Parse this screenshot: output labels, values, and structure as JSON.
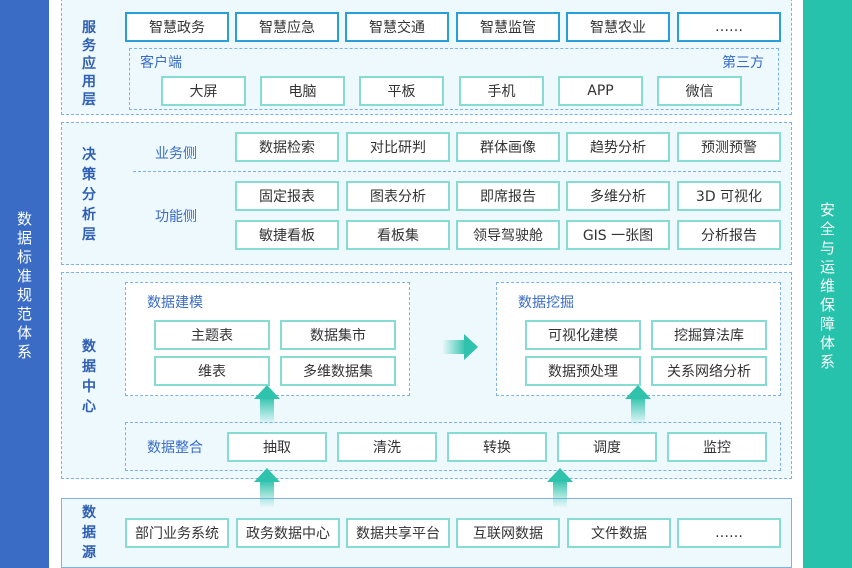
{
  "side": {
    "left": "数据标准规范体系",
    "right": "安全与运维保障体系"
  },
  "service_layer": {
    "title": "服务应用层",
    "apps": [
      "智慧政务",
      "智慧应急",
      "智慧交通",
      "智慧监管",
      "智慧农业",
      "……"
    ],
    "client_label": "客户端",
    "third_party_label": "第三方",
    "clients": [
      "大屏",
      "电脑",
      "平板",
      "手机",
      "APP",
      "微信"
    ]
  },
  "decision_layer": {
    "title": "决策分析层",
    "business_label": "业务侧",
    "business_items": [
      "数据检索",
      "对比研判",
      "群体画像",
      "趋势分析",
      "预测预警"
    ],
    "function_label": "功能侧",
    "function_row1": [
      "固定报表",
      "图表分析",
      "即席报告",
      "多维分析",
      "3D 可视化"
    ],
    "function_row2": [
      "敏捷看板",
      "看板集",
      "领导驾驶舱",
      "GIS 一张图",
      "分析报告"
    ]
  },
  "data_center": {
    "title": "数据中心",
    "modeling": {
      "label": "数据建模",
      "items": [
        "主题表",
        "数据集市",
        "维表",
        "多维数据集"
      ]
    },
    "mining": {
      "label": "数据挖掘",
      "items": [
        "可视化建模",
        "挖掘算法库",
        "数据预处理",
        "关系网络分析"
      ]
    },
    "integration": {
      "label": "数据整合",
      "items": [
        "抽取",
        "清洗",
        "转换",
        "调度",
        "监控"
      ]
    }
  },
  "data_source": {
    "title": "数据源",
    "items": [
      "部门业务系统",
      "政务数据中心",
      "数据共享平台",
      "互联网数据",
      "文件数据",
      "……"
    ]
  }
}
